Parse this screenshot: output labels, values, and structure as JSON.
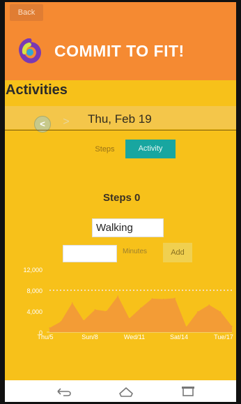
{
  "header": {
    "back_label": "Back",
    "brand_title": "COMMIT TO FIT!"
  },
  "activities": {
    "title": "Activities"
  },
  "date_nav": {
    "prev_symbol": "<",
    "next_symbol": ">",
    "date": "Thu, Feb 19"
  },
  "tabs": [
    {
      "label": "Steps",
      "selected": false
    },
    {
      "label": "Activity",
      "selected": true
    }
  ],
  "steps": {
    "label": "Steps 0"
  },
  "form": {
    "activity_value": "Walking",
    "minutes_value": "",
    "minutes_label": "Minutes",
    "add_label": "Add"
  },
  "chart_data": {
    "type": "area",
    "x": [
      "Thu/5",
      "Sun/8",
      "Wed/11",
      "Sat/14",
      "Tue/17"
    ],
    "y_ticks": [
      0,
      4000,
      8000,
      12000
    ],
    "y_tick_labels": [
      "0",
      "4,000",
      "8,000",
      "12,000"
    ],
    "ylim": [
      0,
      12000
    ],
    "goal_line": 8000,
    "fill_color": "#f29a38",
    "line_color": "#f5dfb8",
    "values": [
      800,
      2000,
      5600,
      2200,
      4300,
      4000,
      6900,
      2600,
      4600,
      6400,
      6300,
      6500,
      1000,
      3900,
      5200,
      3900,
      1100
    ]
  },
  "colors": {
    "header": "#f58a32",
    "body": "#f7c11a",
    "tab_active": "#18a6a0"
  },
  "nav": {
    "icons": [
      "back-icon",
      "home-icon",
      "recent-apps-icon"
    ]
  }
}
